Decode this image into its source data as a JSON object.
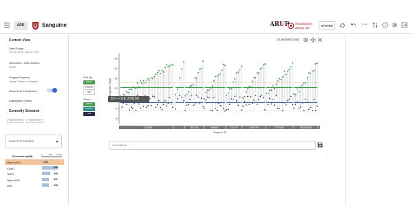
{
  "header": {
    "add_label": "ADD",
    "app_title": "Sanguine",
    "arup_logo": "ARUP",
    "vislab_line1": "visualization",
    "vislab_line2": "design lab",
    "states_label": "STATES",
    "brand_color": "#b3212d"
  },
  "current_view": {
    "title": "Current View",
    "date_range_label": "Date Range",
    "date_range_value": "Jan 01, 2014 - Sep 22, 2021",
    "outcomes_label": "Outcomes / Interventions",
    "outcomes_value": "NONE",
    "urgency_label": "Surgery Urgency",
    "urgency_value": "Urgent, Elective, Emergent",
    "zero_transfused_label": "Show Zero Transfused",
    "zero_transfused_on": true,
    "aggregated_label": "Aggregated Cases"
  },
  "currently_selected": {
    "title": "Currently Selected",
    "chip1": "CREATE FILTER",
    "chip2": "CLEAR FILTER"
  },
  "search": {
    "placeholder": "Search Procedure"
  },
  "procedures": {
    "header": "Procedures(69)",
    "axis_ticks": [
      "0",
      "500",
      "1,000"
    ],
    "items": [
      {
        "name": "Open MVR",
        "count": "231",
        "fraction": 0.1,
        "selected": true
      },
      {
        "name": "CABG",
        "count": "998",
        "fraction": 1.0,
        "selected": false
      },
      {
        "name": "TAVR",
        "count": "540",
        "fraction": 0.54,
        "selected": false
      },
      {
        "name": "Open AVR",
        "count": "447",
        "fraction": 0.45,
        "selected": false
      },
      {
        "name": "VAD",
        "count": "439",
        "fraction": 0.44,
        "selected": false
      }
    ]
  },
  "controls": {
    "sort_by_label": "Sort By",
    "sort_options": [
      "PREOP",
      "POSTOP",
      "GAP"
    ],
    "show_label": "Show",
    "show_options": [
      "PREOP",
      "POSTOP",
      "GAP"
    ]
  },
  "chart": {
    "title": "Dumbbell Chart",
    "tooltip": "8.5 -> 6.4, 279156",
    "ylabel": "Hemoglobin Value",
    "xlabel": "Surgeon ID",
    "y_ticks": [
      "18",
      "16",
      "14",
      "12",
      "10",
      "8",
      "6"
    ],
    "surgeon_ids": [
      "279156",
      "",
      "267245",
      "666667",
      "011473",
      "3459790",
      "5779806",
      "406226835"
    ],
    "preop_color": "#3a9a4a",
    "postop_color": "#2d3a5a"
  },
  "chart_data": {
    "type": "scatter",
    "xlabel": "Surgeon ID",
    "ylabel": "Hemoglobin Value",
    "ylim": [
      5,
      19
    ],
    "tooltip": "8.5 -> 6.4, 279156",
    "categories": [
      "279156",
      "",
      "267245",
      "666667",
      "011473",
      "3459790",
      "5779806",
      "406226835"
    ]
  },
  "annotation": {
    "placeholder": "Annotation"
  }
}
